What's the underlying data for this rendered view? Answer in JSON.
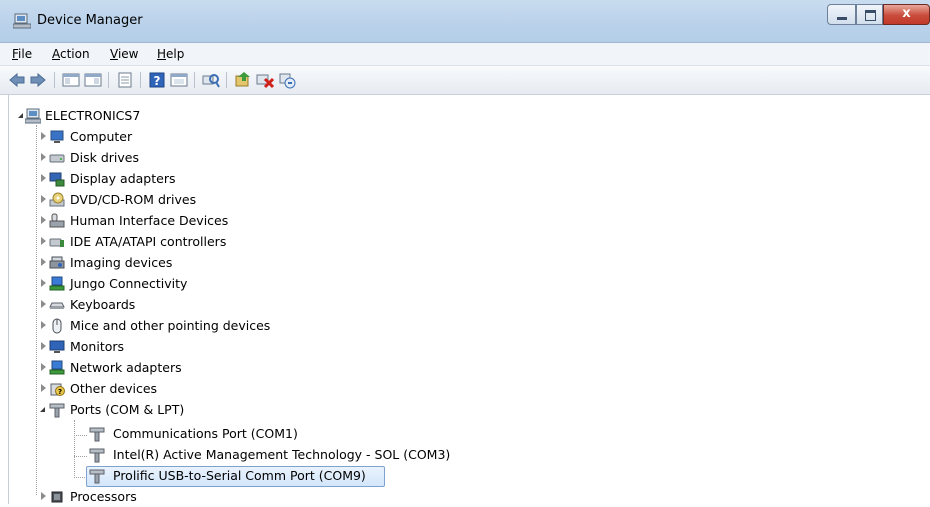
{
  "window": {
    "title": "Device Manager",
    "close_glyph": "x"
  },
  "menu": [
    {
      "acc": "F",
      "rest": "ile"
    },
    {
      "acc": "A",
      "rest": "ction"
    },
    {
      "acc": "V",
      "rest": "iew"
    },
    {
      "acc": "H",
      "rest": "elp"
    }
  ],
  "toolbar": [
    "back-arrow-icon",
    "forward-arrow-icon",
    "show-hide-console-tree-icon",
    "properties-icon",
    "help-icon",
    "action-pane-icon",
    "scan-hardware-icon",
    "update-driver-icon",
    "uninstall-device-icon",
    "disable-device-icon"
  ],
  "tree": {
    "root": "ELECTRONICS7",
    "categories": [
      "Computer",
      "Disk drives",
      "Display adapters",
      "DVD/CD-ROM drives",
      "Human Interface Devices",
      "IDE ATA/ATAPI controllers",
      "Imaging devices",
      "Jungo Connectivity",
      "Keyboards",
      "Mice and other pointing devices",
      "Monitors",
      "Network adapters",
      "Other devices",
      "Ports (COM & LPT)"
    ],
    "ports": [
      "Communications Port (COM1)",
      "Intel(R) Active Management Technology - SOL (COM3)",
      "Prolific USB-to-Serial Comm Port (COM9)"
    ],
    "after_ports": [
      "Processors"
    ],
    "selected": "Prolific USB-to-Serial Comm Port (COM9)"
  },
  "colors": {
    "titlebar": "#b9d1ea",
    "selection": "#d3e6fb",
    "close": "#c94c3b"
  }
}
